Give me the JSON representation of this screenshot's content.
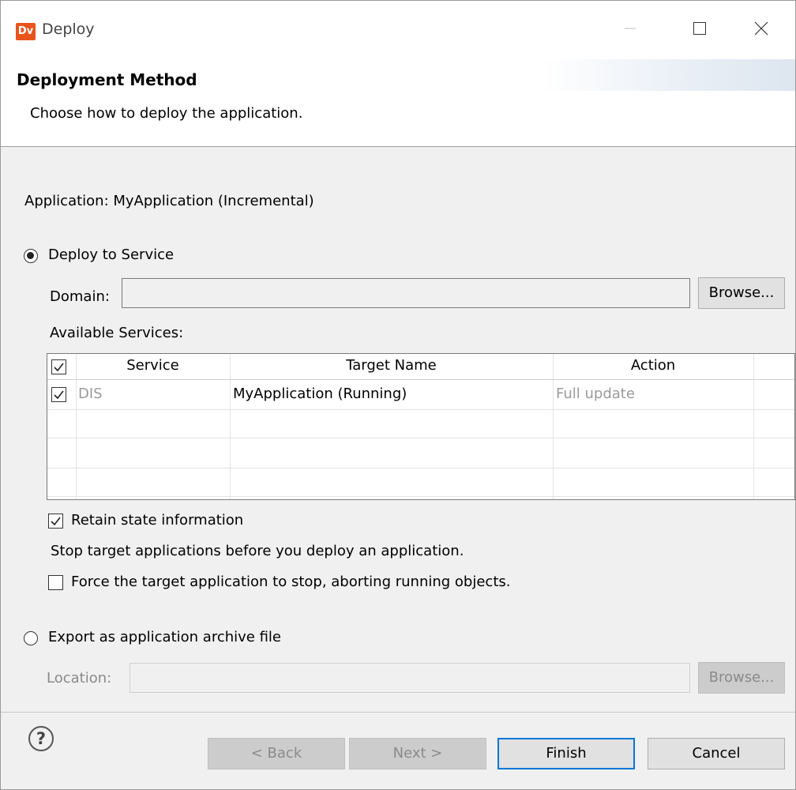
{
  "window": {
    "title": "Deploy",
    "logo_text": "Dv"
  },
  "header": {
    "title": "Deployment Method",
    "description": "Choose how to deploy the application."
  },
  "application_label": "Application: MyApplication (Incremental)",
  "deploy_to_service": {
    "label": "Deploy to Service",
    "selected": true,
    "domain_label": "Domain:",
    "domain_value": "",
    "browse_label": "Browse...",
    "available_services_label": "Available Services:",
    "table": {
      "columns": [
        "Service",
        "Target Name",
        "Action"
      ],
      "rows": [
        {
          "checked": true,
          "service": "DIS",
          "target_name": "MyApplication (Running)",
          "action": "Full update"
        }
      ]
    },
    "retain_state": {
      "label": "Retain state information",
      "checked": true
    },
    "stop_note": "Stop target applications before you deploy an application.",
    "force_stop": {
      "label": "Force the target application to stop, aborting running objects.",
      "checked": false
    }
  },
  "export_archive": {
    "label": "Export as application archive file",
    "selected": false,
    "location_label": "Location:",
    "location_value": "",
    "browse_label": "Browse..."
  },
  "footer": {
    "help_glyph": "?",
    "back_label": "< Back",
    "next_label": "Next >",
    "finish_label": "Finish",
    "cancel_label": "Cancel"
  },
  "colors": {
    "accent": "#0078d7",
    "logo": "#e8541c",
    "disabled_text": "#8a8a8a"
  }
}
